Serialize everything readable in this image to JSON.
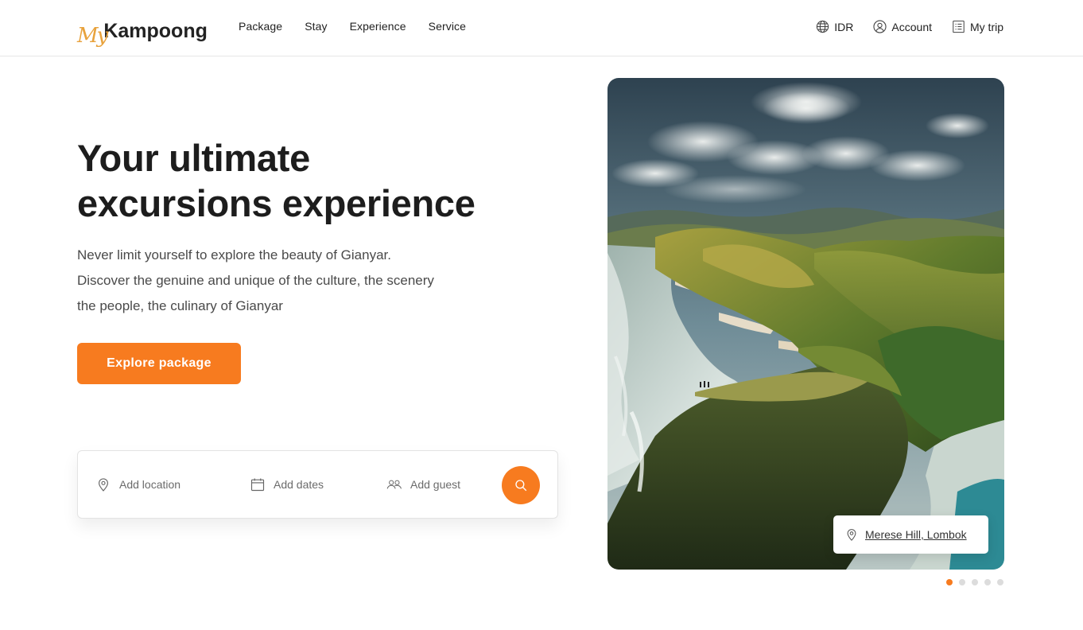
{
  "brand": {
    "logo_script": "My",
    "logo_main": "Kampoong",
    "accent_color": "#f77b1f",
    "logo_script_color": "#e8a23c"
  },
  "nav": {
    "links": [
      "Package",
      "Stay",
      "Experience",
      "Service"
    ],
    "currency": "IDR",
    "account": "Account",
    "trip": "My trip"
  },
  "hero": {
    "title_line1": "Your ultimate",
    "title_line2": "excursions experience",
    "desc_line1": "Never limit yourself to explore the beauty of Gianyar.",
    "desc_line2": "Discover the genuine and unique of the culture, the scenery",
    "desc_line3": "the people, the culinary of Gianyar",
    "cta_label": "Explore package"
  },
  "search": {
    "location_placeholder": "Add location",
    "dates_placeholder": "Add dates",
    "guest_placeholder": "Add guest",
    "icons": [
      "location-pin-icon",
      "calendar-icon",
      "guests-icon",
      "search-icon"
    ]
  },
  "showcase": {
    "location_label": "Merese Hill, Lombok",
    "slides": 5,
    "active_slide": 1
  }
}
